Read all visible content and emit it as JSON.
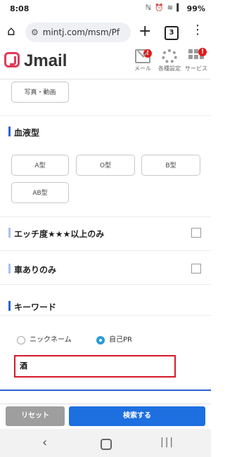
{
  "status_bar": {
    "time": "8:08",
    "icons": "ℕ ⏰ ≋ ▍",
    "battery": "99%"
  },
  "browser": {
    "url": "mintj.com/msm/Pf",
    "tab_count": "3"
  },
  "site": {
    "logo": "Jmail",
    "nav": [
      {
        "label": "メール",
        "badge": "!"
      },
      {
        "label": "各種設定"
      },
      {
        "label": "サービス",
        "badge": "!"
      }
    ]
  },
  "photo_chip": "写真・動画",
  "blood_type": {
    "title": "血液型",
    "options": [
      "A型",
      "O型",
      "B型",
      "AB型"
    ]
  },
  "filters": {
    "ecchi": "エッチ度★★★以上のみ",
    "car": "車ありのみ"
  },
  "keyword": {
    "title": "キーワード",
    "radio_nickname": "ニックネーム",
    "radio_pr": "自己PR",
    "value": "酒"
  },
  "buttons": {
    "reset": "リセット",
    "search": "検索する"
  }
}
